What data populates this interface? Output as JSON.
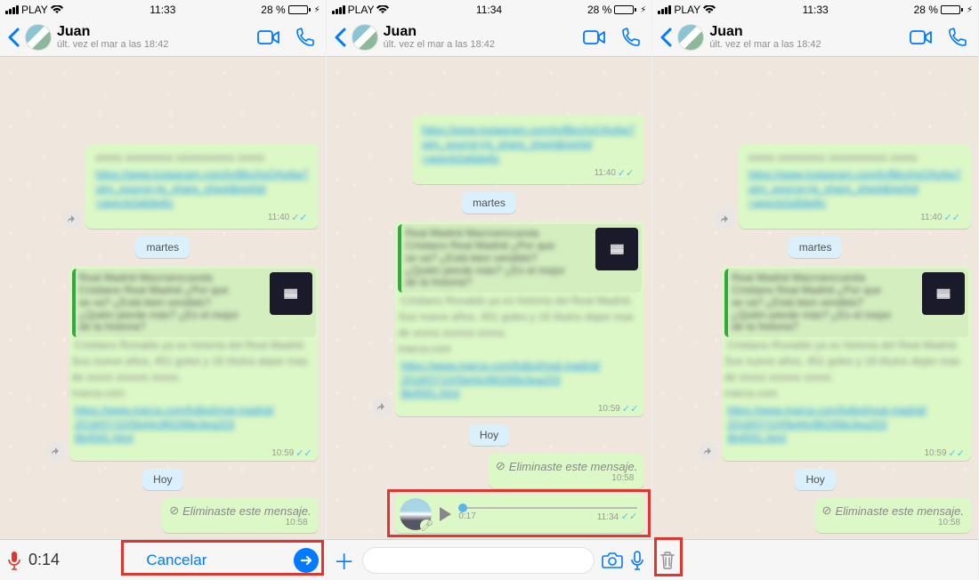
{
  "status": {
    "carrier": "PLAY",
    "battery_text": "28 %",
    "times": [
      "11:33",
      "11:34",
      "11:33"
    ]
  },
  "header": {
    "name": "Juan",
    "last_seen": "últ. vez el mar a las 18:42"
  },
  "chat": {
    "day1": "martes",
    "day2": "Hoy",
    "deleted_text": "Eliminaste este mensaje.",
    "deleted_time": "10:58",
    "msg_time": "10:59",
    "link_time": "11:40",
    "voice_duration": "0:17",
    "voice_time": "11:34"
  },
  "bottom": {
    "rec_time": "0:14",
    "cancel": "Cancelar"
  }
}
